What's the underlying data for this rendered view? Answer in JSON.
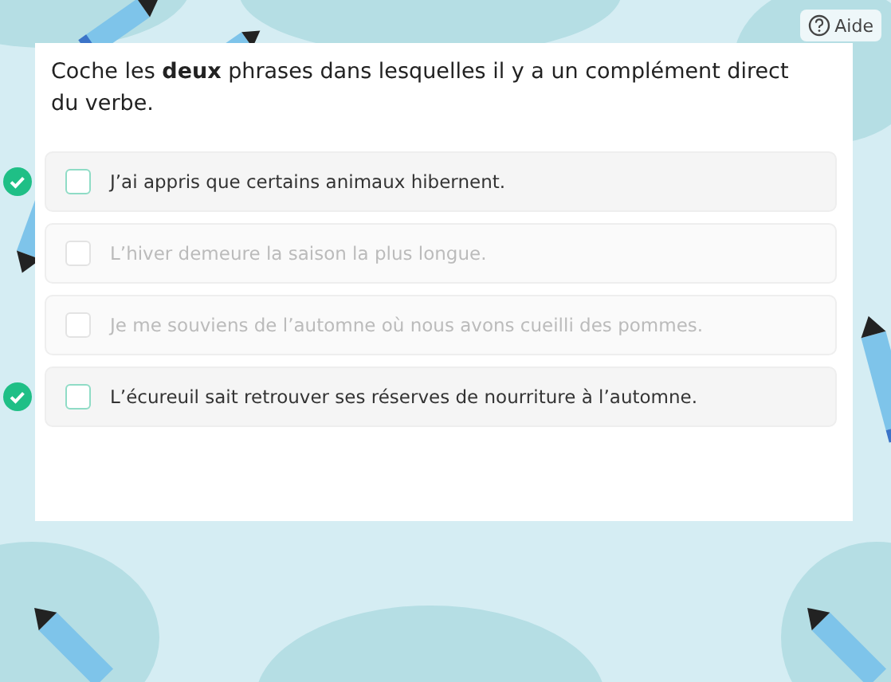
{
  "help_button": {
    "label": "Aide"
  },
  "question": "Coche les **deux** phrases dans lesquelles il y a un complément direct du verbe.",
  "options": [
    {
      "text": "J’ai appris que certains animaux hibernent.",
      "correct": true,
      "disabled": false
    },
    {
      "text": "L’hiver demeure la saison la plus longue.",
      "correct": false,
      "disabled": true
    },
    {
      "text": "Je me souviens de l’automne où nous avons cueilli des pommes.",
      "correct": false,
      "disabled": true
    },
    {
      "text": "L’écureuil sait retrouver ses réserves de nourriture à l’automne.",
      "correct": true,
      "disabled": false
    }
  ]
}
